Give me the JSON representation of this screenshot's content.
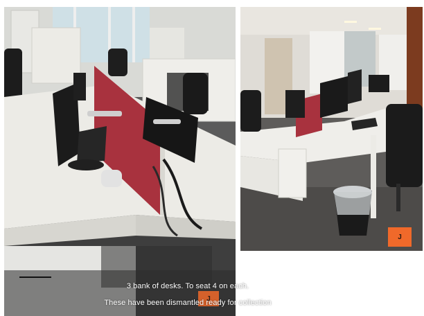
{
  "captions": {
    "line1": "3 bank of desks. To seat 4 on each.",
    "line2": "These have been dismantled ready for collection"
  },
  "badges": {
    "right_photo": "J",
    "left_photo": "J"
  },
  "colors": {
    "desk_white": "#ecebe6",
    "divider_red": "#a8323e",
    "carpet": "#4a4a4a",
    "badge_orange": "#f0692a"
  }
}
